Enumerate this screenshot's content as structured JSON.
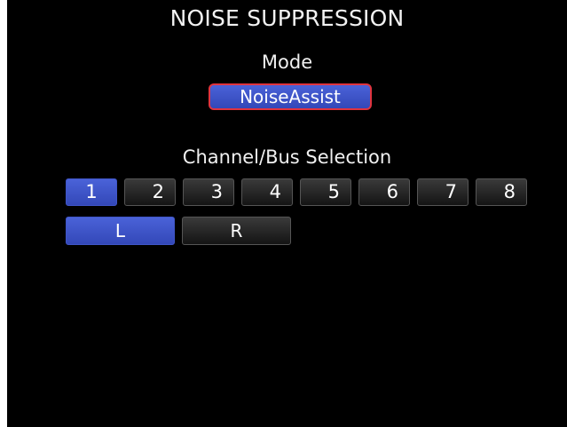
{
  "screen": {
    "title": "NOISE SUPPRESSION",
    "mode_label": "Mode",
    "mode_value": "NoiseAssist",
    "bus_label": "Channel/Bus Selection",
    "channels": [
      {
        "label": "1",
        "active": true
      },
      {
        "label": "2",
        "active": false
      },
      {
        "label": "3",
        "active": false
      },
      {
        "label": "4",
        "active": false
      },
      {
        "label": "5",
        "active": false
      },
      {
        "label": "6",
        "active": false
      },
      {
        "label": "7",
        "active": false
      },
      {
        "label": "8",
        "active": false
      }
    ],
    "buses": [
      {
        "label": "L",
        "active": true
      },
      {
        "label": "R",
        "active": false
      }
    ]
  },
  "colors": {
    "background": "#000000",
    "selected": "#3f55c8",
    "mode_border": "#e0343f",
    "button_dark": "#1e1e1e"
  }
}
